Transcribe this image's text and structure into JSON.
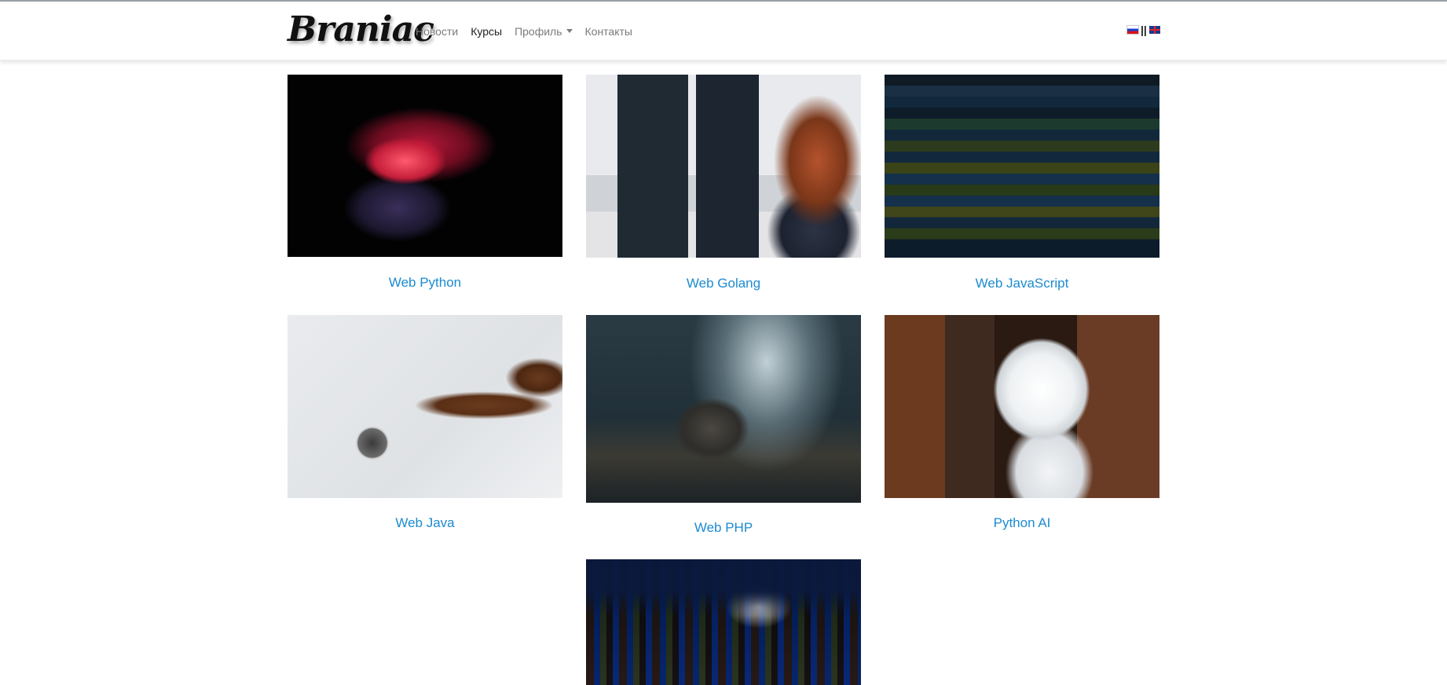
{
  "brand": {
    "logo_text": "Braniac"
  },
  "nav": {
    "items": [
      {
        "label": "Новости"
      },
      {
        "label": "Курсы"
      },
      {
        "label": "Профиль"
      },
      {
        "label": "Контакты"
      }
    ],
    "separator": "||"
  },
  "languages": [
    "ru-flag-icon",
    "en-flag-icon"
  ],
  "courses": [
    {
      "title": "Web Python",
      "image": "snake-image"
    },
    {
      "title": "Web Golang",
      "image": "office-workstation-image"
    },
    {
      "title": "Web JavaScript",
      "image": "code-screen-image"
    },
    {
      "title": "Web Java",
      "image": "coffee-beans-image"
    },
    {
      "title": "Web PHP",
      "image": "forest-elephant-image"
    },
    {
      "title": "Python AI",
      "image": "robot-image"
    },
    {
      "title": "",
      "image": "container-ship-image"
    }
  ],
  "colors": {
    "link": "#1b8bd0",
    "nav_text": "#7b7b7b",
    "nav_active": "#222222"
  }
}
